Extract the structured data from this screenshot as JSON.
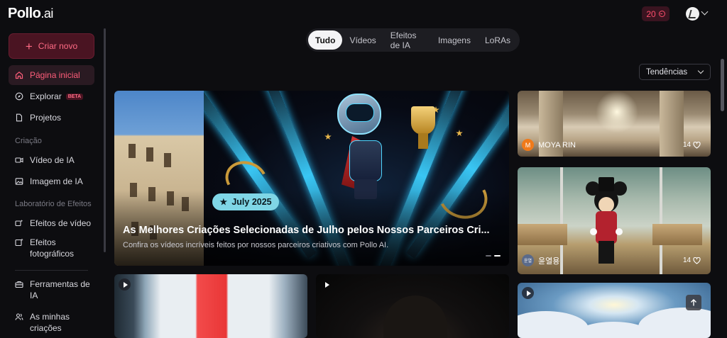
{
  "header": {
    "logo_main": "Pollo",
    "logo_suffix": ".ai",
    "credits": "20"
  },
  "sidebar": {
    "create_label": "Criar novo",
    "items": [
      {
        "label": "Página inicial",
        "active": true
      },
      {
        "label": "Explorar",
        "badge": "BETA"
      },
      {
        "label": "Projetos"
      }
    ],
    "section_creation": "Criação",
    "creation_items": [
      {
        "label": "Vídeo de IA"
      },
      {
        "label": "Imagem de IA"
      }
    ],
    "section_lab": "Laboratório de Efeitos",
    "lab_items": [
      {
        "label": "Efeitos de vídeo"
      },
      {
        "label": "Efeitos fotográficos"
      }
    ],
    "bottom_items": [
      {
        "label": "Ferramentas de IA"
      },
      {
        "label": "As minhas criações"
      }
    ]
  },
  "tabs": [
    {
      "label": "Tudo",
      "active": true
    },
    {
      "label": "Vídeos"
    },
    {
      "label": "Efeitos de IA"
    },
    {
      "label": "Imagens"
    },
    {
      "label": "LoRAs"
    }
  ],
  "sort": {
    "label": "Tendências"
  },
  "hero": {
    "badge": "July 2025",
    "title": "As Melhores Criações Selecionadas de Julho pelos Nossos Parceiros Cri...",
    "subtitle": "Confira os vídeos incríveis feitos por nossos parceiros criativos com Pollo AI."
  },
  "cards": [
    {
      "author": "MOYA RIN",
      "avatar_letter": "M",
      "avatar_color": "#f07a1a",
      "likes": "14"
    },
    {
      "author": "윤열용",
      "avatar_letter": "윤열",
      "avatar_color": "#5a6a8a",
      "likes": "14"
    }
  ],
  "colors": {
    "accent": "#ff4f6d",
    "badge": "#7fd6e6",
    "background": "#0d0d10"
  }
}
